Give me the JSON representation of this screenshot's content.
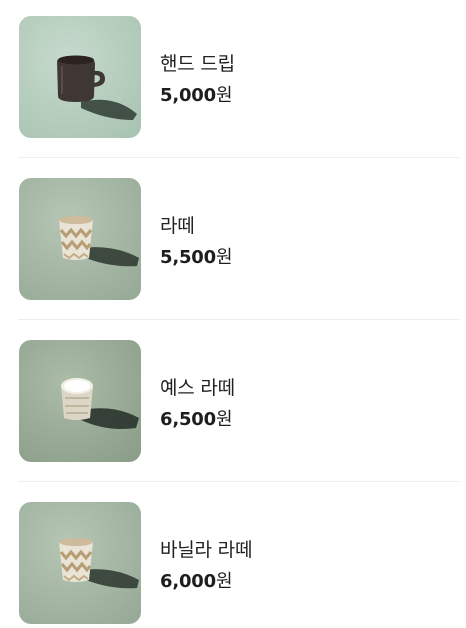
{
  "menu": {
    "items": [
      {
        "name": "핸드 드립",
        "price": "5,000",
        "currency": "원",
        "icon": "mug-icon",
        "bg": "#b9d0c1"
      },
      {
        "name": "라떼",
        "price": "5,500",
        "currency": "원",
        "icon": "iced-latte-glass-icon",
        "bg": "#a9bba8"
      },
      {
        "name": "예스 라떼",
        "price": "6,500",
        "currency": "원",
        "icon": "latte-glass-icon",
        "bg": "#9fae9b"
      },
      {
        "name": "바닐라 라떼",
        "price": "6,000",
        "currency": "원",
        "icon": "iced-latte-glass-icon",
        "bg": "#a9bba8"
      }
    ]
  }
}
